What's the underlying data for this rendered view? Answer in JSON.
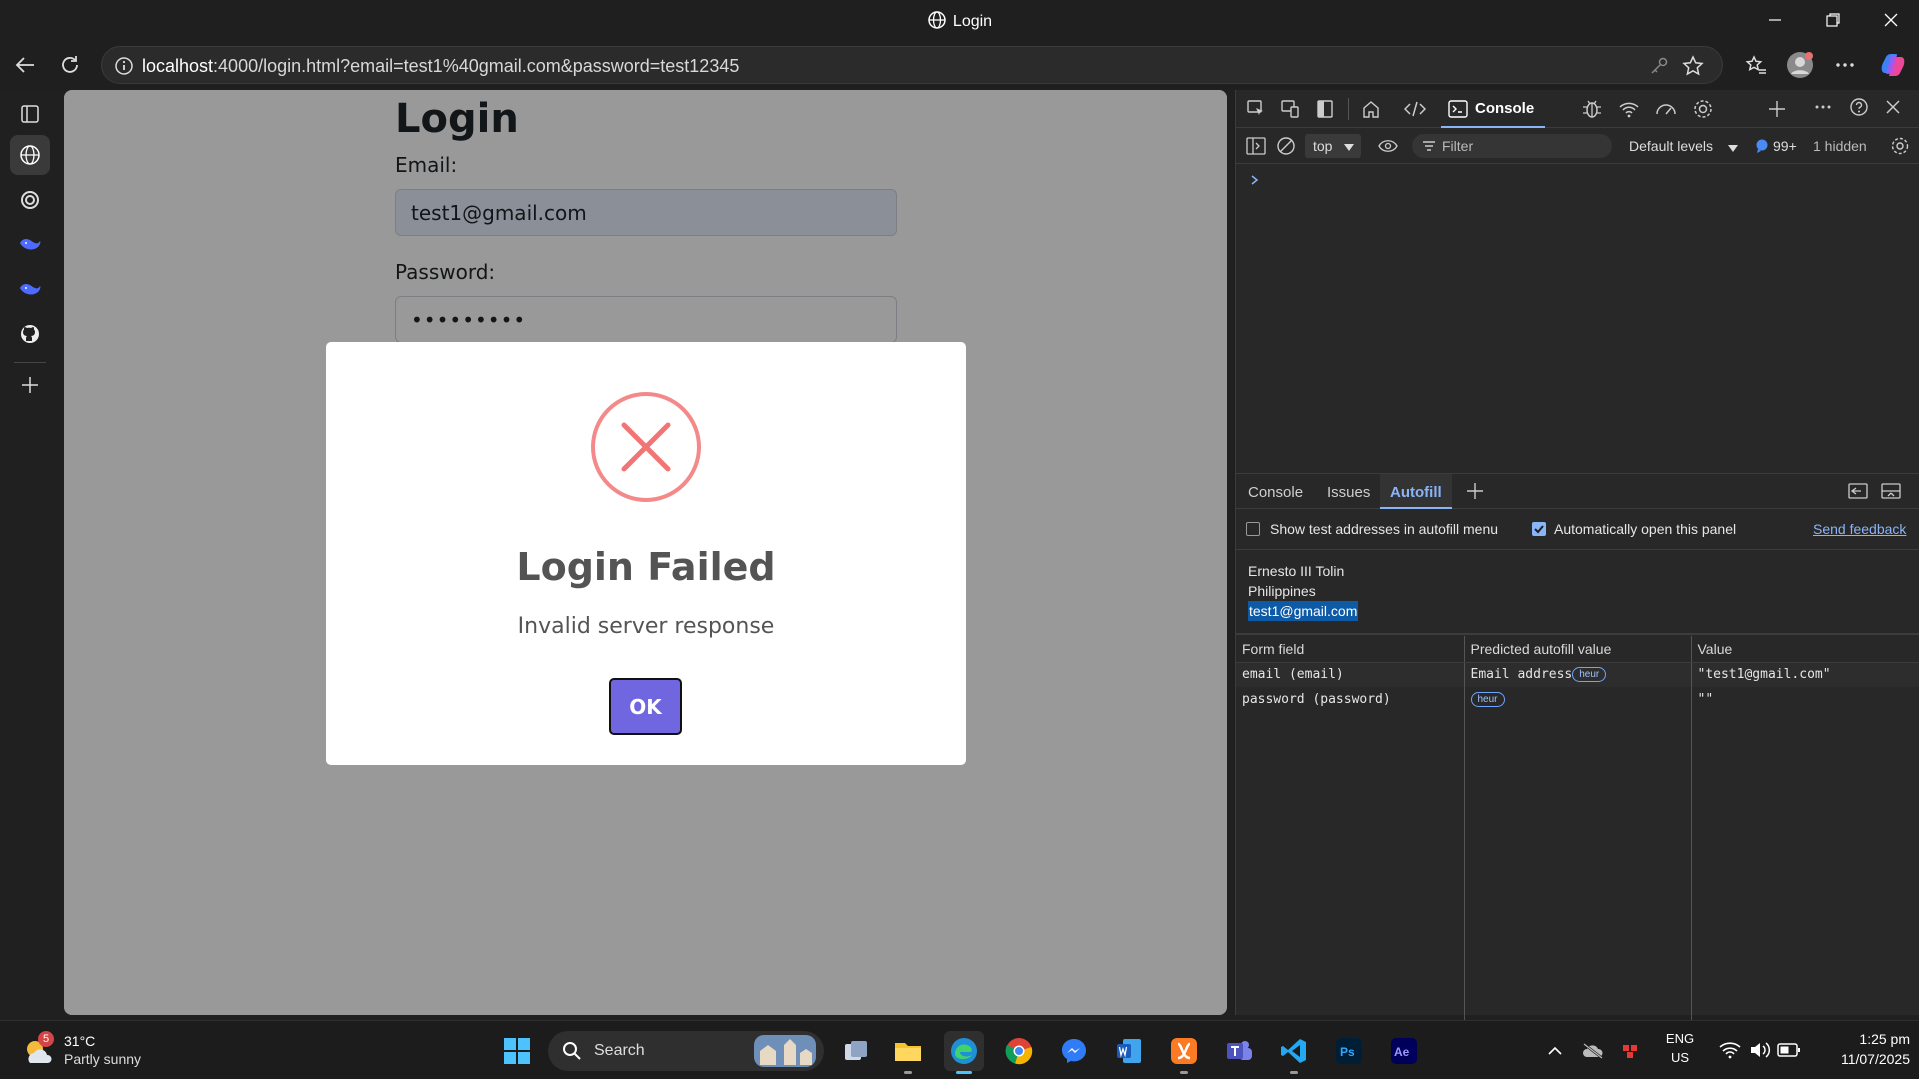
{
  "window": {
    "title": "Login"
  },
  "address_bar": {
    "host": "localhost",
    "rest": ":4000/login.html?email=test1%40gmail.com&password=test12345"
  },
  "page": {
    "heading": "Login",
    "email_label": "Email:",
    "email_value": "test1@gmail.com",
    "password_label": "Password:",
    "password_value": "•••••••••"
  },
  "modal": {
    "title": "Login Failed",
    "message": "Invalid server response",
    "ok_label": "OK",
    "icon_color": "#f27474"
  },
  "devtools": {
    "top_tab": "Console",
    "context": "top",
    "filter_placeholder": "Filter",
    "levels": "Default levels",
    "issues_count": "99+",
    "hidden": "1 hidden",
    "drawer_tabs": [
      "Console",
      "Issues",
      "Autofill"
    ],
    "autofill": {
      "show_test_label": "Show test addresses in autofill menu",
      "auto_open_label": "Automatically open this panel",
      "feedback": "Send feedback",
      "profile": [
        "Ernesto III Tolin",
        "Philippines",
        "test1@gmail.com"
      ],
      "columns": [
        "Form field",
        "Predicted autofill value",
        "Value"
      ],
      "rows": [
        {
          "field": "email (email)",
          "predicted": "Email address",
          "badge": "heur",
          "value": "\"test1@gmail.com\""
        },
        {
          "field": "password (password)",
          "predicted": "",
          "badge": "heur",
          "value": "\"\""
        }
      ]
    }
  },
  "taskbar": {
    "weather_temp": "31°C",
    "weather_desc": "Partly sunny",
    "weather_badge": "5",
    "search_label": "Search",
    "lang": "ENG",
    "region": "US",
    "time": "1:25 pm",
    "date": "11/07/2025"
  },
  "colors": {
    "accent": "#7066e0",
    "devtools_accent": "#8ab4f8",
    "error": "#f27474"
  }
}
